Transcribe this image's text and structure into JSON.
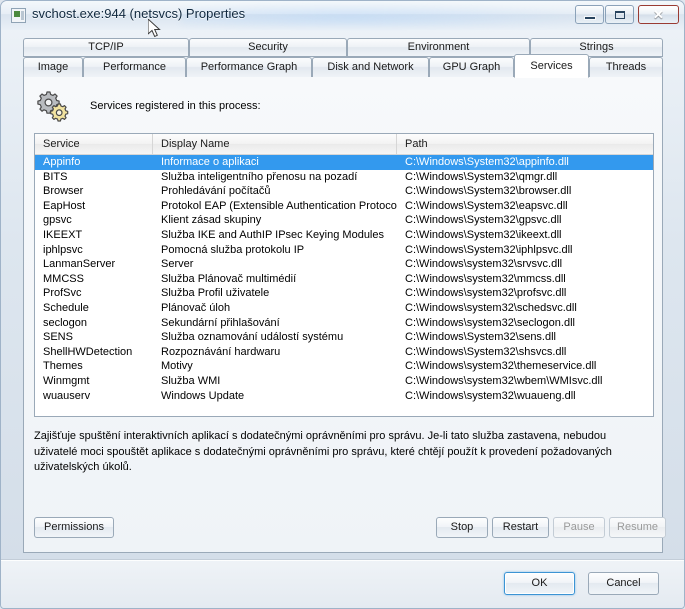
{
  "window": {
    "title": "svchost.exe:944 (netsvcs) Properties",
    "icon": "application-icon",
    "controls": {
      "minimize": "minimize-icon",
      "maximize": "maximize-icon",
      "close": "✕"
    }
  },
  "tabs": {
    "row1": [
      {
        "label": "TCP/IP"
      },
      {
        "label": "Security"
      },
      {
        "label": "Environment"
      },
      {
        "label": "Strings"
      }
    ],
    "row2": [
      {
        "label": "Image"
      },
      {
        "label": "Performance"
      },
      {
        "label": "Performance Graph"
      },
      {
        "label": "Disk and Network"
      },
      {
        "label": "GPU Graph"
      },
      {
        "label": "Services"
      },
      {
        "label": "Threads"
      }
    ],
    "selected": "Services"
  },
  "header": {
    "icon": "gears-icon",
    "label": "Services registered in this process:"
  },
  "table": {
    "columns": [
      "Service",
      "Display Name",
      "Path"
    ],
    "selected_index": 0,
    "rows": [
      {
        "service": "Appinfo",
        "display": "Informace o aplikaci",
        "path": "C:\\Windows\\System32\\appinfo.dll"
      },
      {
        "service": "BITS",
        "display": "Služba inteligentního přenosu na pozadí",
        "path": "C:\\Windows\\System32\\qmgr.dll"
      },
      {
        "service": "Browser",
        "display": "Prohledávání počítačů",
        "path": "C:\\Windows\\System32\\browser.dll"
      },
      {
        "service": "EapHost",
        "display": "Protokol EAP (Extensible Authentication Protocol)",
        "path": "C:\\Windows\\System32\\eapsvc.dll"
      },
      {
        "service": "gpsvc",
        "display": "Klient zásad skupiny",
        "path": "C:\\Windows\\System32\\gpsvc.dll"
      },
      {
        "service": "IKEEXT",
        "display": "Služba IKE and AuthIP IPsec Keying Modules",
        "path": "C:\\Windows\\System32\\ikeext.dll"
      },
      {
        "service": "iphlpsvc",
        "display": "Pomocná služba protokolu IP",
        "path": "C:\\Windows\\System32\\iphlpsvc.dll"
      },
      {
        "service": "LanmanServer",
        "display": "Server",
        "path": "C:\\Windows\\system32\\srvsvc.dll"
      },
      {
        "service": "MMCSS",
        "display": "Služba Plánovač multimédií",
        "path": "C:\\Windows\\system32\\mmcss.dll"
      },
      {
        "service": "ProfSvc",
        "display": "Služba Profil uživatele",
        "path": "C:\\Windows\\system32\\profsvc.dll"
      },
      {
        "service": "Schedule",
        "display": "Plánovač úloh",
        "path": "C:\\Windows\\system32\\schedsvc.dll"
      },
      {
        "service": "seclogon",
        "display": "Sekundární přihlašování",
        "path": "C:\\Windows\\system32\\seclogon.dll"
      },
      {
        "service": "SENS",
        "display": "Služba oznamování událostí systému",
        "path": "C:\\Windows\\System32\\sens.dll"
      },
      {
        "service": "ShellHWDetection",
        "display": "Rozpoznávání hardwaru",
        "path": "C:\\Windows\\System32\\shsvcs.dll"
      },
      {
        "service": "Themes",
        "display": "Motivy",
        "path": "C:\\Windows\\system32\\themeservice.dll"
      },
      {
        "service": "Winmgmt",
        "display": "Služba WMI",
        "path": "C:\\Windows\\system32\\wbem\\WMIsvc.dll"
      },
      {
        "service": "wuauserv",
        "display": "Windows Update",
        "path": "C:\\Windows\\system32\\wuaueng.dll"
      }
    ]
  },
  "description": "Zajišťuje spuštění interaktivních aplikací s dodatečnými oprávněními pro správu. Je-li tato služba zastavena, nebudou uživatelé moci spouštět aplikace s dodatečnými oprávněními pro správu, které chtějí použít k provedení požadovaných uživatelských úkolů.",
  "service_buttons": {
    "permissions": "Permissions",
    "stop": "Stop",
    "restart": "Restart",
    "pause": "Pause",
    "resume": "Resume"
  },
  "footer": {
    "ok": "OK",
    "cancel": "Cancel"
  },
  "colors": {
    "selection": "#3399ee",
    "close_button": "#c0392b",
    "accent_focus": "#3c94d4"
  }
}
